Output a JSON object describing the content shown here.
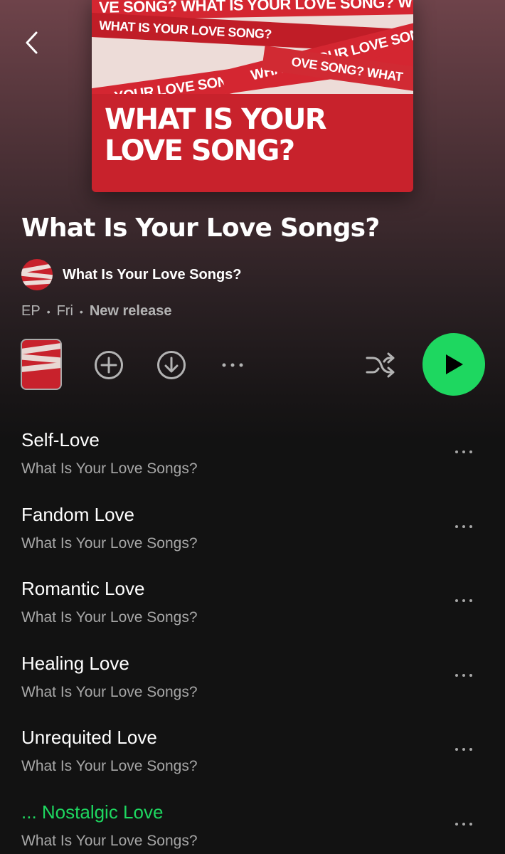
{
  "cover": {
    "title": "WHAT IS YOUR LOVE SONG?",
    "strip_texts": [
      "VE SONG?  WHAT IS YOUR LOVE SONG?  WHA",
      "WHAT IS YOUR LOVE SONG?",
      "WHAT IS YOUR LOVE SONG",
      "... YOUR LOVE SONG?",
      "OVE SONG? WHAT"
    ]
  },
  "album": {
    "title": "What Is Your Love Songs?",
    "artist": "What Is Your Love Songs?",
    "type": "EP",
    "date": "Fri",
    "status": "New release"
  },
  "colors": {
    "accent": "#1ed760",
    "background": "#121212",
    "secondary_text": "#a7a7a7"
  },
  "tracks": [
    {
      "title": "Self-Love",
      "artist": "What Is Your Love Songs?",
      "playing": false
    },
    {
      "title": "Fandom Love",
      "artist": "What Is Your Love Songs?",
      "playing": false
    },
    {
      "title": "Romantic Love",
      "artist": "What Is Your Love Songs?",
      "playing": false
    },
    {
      "title": "Healing Love",
      "artist": "What Is Your Love Songs?",
      "playing": false
    },
    {
      "title": "Unrequited Love",
      "artist": "What Is Your Love Songs?",
      "playing": false
    },
    {
      "title": "... Nostalgic Love",
      "artist": "What Is Your Love Songs?",
      "playing": true
    }
  ],
  "icons": {
    "back": "chevron-left-icon",
    "add": "plus-circle-icon",
    "download": "download-circle-icon",
    "more": "more-horizontal-icon",
    "shuffle": "shuffle-icon",
    "play": "play-icon"
  }
}
